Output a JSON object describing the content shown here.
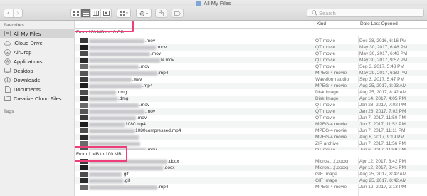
{
  "window": {
    "title": "All My Files"
  },
  "toolbar": {
    "back": "‹",
    "forward": "›",
    "search_placeholder": "Search"
  },
  "sidebar": {
    "favorites_label": "Favorites",
    "tags_label": "Tags",
    "items": [
      {
        "label": "All My Files",
        "icon": "all-files-icon",
        "active": true
      },
      {
        "label": "iCloud Drive",
        "icon": "cloud-icon"
      },
      {
        "label": "AirDrop",
        "icon": "airdrop-icon"
      },
      {
        "label": "Applications",
        "icon": "applications-icon"
      },
      {
        "label": "Desktop",
        "icon": "desktop-icon"
      },
      {
        "label": "Downloads",
        "icon": "downloads-icon"
      },
      {
        "label": "Documents",
        "icon": "documents-icon"
      },
      {
        "label": "Creative Cloud Files",
        "icon": "creative-cloud-icon"
      }
    ]
  },
  "columns": {
    "kind": "Kind",
    "date": "Date Last Opened"
  },
  "groups": [
    {
      "label": "From 100 MB to 10 GB"
    },
    {
      "label": "From 1 MB to 100 MB"
    }
  ],
  "rows_group1": [
    {
      "ext": ".mov",
      "kind": "QT movie",
      "date": "Dec 28, 2016, 6:16 PM"
    },
    {
      "ext": ".mov",
      "kind": "QT movie",
      "date": "May 30, 2017, 6:48 PM"
    },
    {
      "ext": ".mov",
      "kind": "QT movie",
      "date": "May 30, 2017, 6:46 PM"
    },
    {
      "ext": "N.mov",
      "kind": "QT movie",
      "date": "May 30, 2017, 9:57 PM"
    },
    {
      "ext": ".mov",
      "kind": "QT movie",
      "date": "Sep 3, 2017, 5:43 PM"
    },
    {
      "ext": ".mp4",
      "kind": "MPEG-4 movie",
      "date": "May 29, 2017, 6:59 PM"
    },
    {
      "ext": ".wav",
      "kind": "Waveform audio",
      "date": "Sep 3, 2017, 5:47 PM"
    },
    {
      "ext": ".mp4",
      "kind": "MPEG-4 movie",
      "date": "Aug 25, 2017, 8:23 AM"
    },
    {
      "ext": ".dmg",
      "kind": "Disk Image",
      "date": "Aug 25, 2017, 8:42 AM"
    },
    {
      "ext": ".dmg",
      "kind": "Disk Image",
      "date": "Apr 14, 2017, 4:05 PM"
    },
    {
      "ext": ".mov",
      "kind": "QT movie",
      "date": "Jan 28, 2017, 7:02 PM"
    },
    {
      "ext": ".mov",
      "kind": "QT movie",
      "date": "Jan 28, 2017, 7:02 PM"
    },
    {
      "ext": ".mov",
      "kind": "QT movie",
      "date": "Jun 7, 2017, 11:50 PM"
    },
    {
      "ext": "1080.mp4",
      "kind": "MPEG-4 movie",
      "date": "Jun 7, 2017, 11:52 PM"
    },
    {
      "ext": "1080compressed.mp4",
      "kind": "MPEG-4 movie",
      "date": "Jun 7, 2017, 11:11 PM"
    },
    {
      "ext": "",
      "kind": "MPEG-4 movie",
      "date": "Aug 8, 2017, 9:19 PM"
    },
    {
      "ext": "",
      "kind": "ZIP archive",
      "date": "Jun 7, 2017, 11:56 PM"
    },
    {
      "ext": ".mov",
      "kind": "QT movie",
      "date": "Jun 6, 2017, 11:59 PM"
    }
  ],
  "rows_group2": [
    {
      "ext": ".docx",
      "kind": "Micros....(.docx)",
      "date": "Apr 12, 2017, 8:42 PM"
    },
    {
      "ext": ".docx",
      "kind": "Micros....(.docx)",
      "date": "Apr 12, 2017, 8:41 PM"
    },
    {
      "ext": ".gif",
      "kind": "GIF Image",
      "date": "Aug 25, 2017, 8:42 AM"
    },
    {
      "ext": ".gif",
      "kind": "GIF Image",
      "date": "Aug 25, 2017, 8:42 AM"
    },
    {
      "ext": ".mp4",
      "kind": "MPEG-4 movie",
      "date": "Jun 12, 2017, 2:13 PM"
    }
  ]
}
